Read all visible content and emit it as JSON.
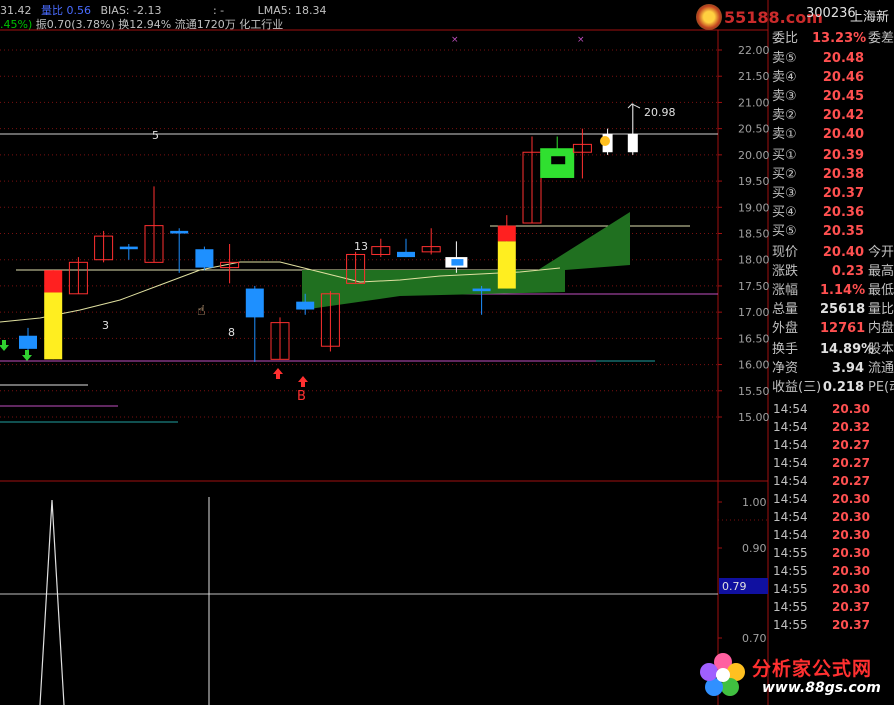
{
  "header": {
    "line1_left": "31.42",
    "line1_label": "量比",
    "line1_value": "0.56",
    "bias": "BIAS: -2.13",
    "colon": ": -",
    "lma": "LMA5: 18.34",
    "line2_pct": ".45%)",
    "line2_rest": "振0.70(3.78%) 换12.94% 流通1720万 化工行业"
  },
  "stock": {
    "code": "300236",
    "name": "上海新",
    "watermark": "55188.com"
  },
  "quote_panel": {
    "weibi": {
      "label": "委比",
      "value": "13.23%",
      "extra": "委差"
    },
    "asks": [
      {
        "label": "卖⑤",
        "value": "20.48"
      },
      {
        "label": "卖④",
        "value": "20.46"
      },
      {
        "label": "卖③",
        "value": "20.45"
      },
      {
        "label": "卖②",
        "value": "20.42"
      },
      {
        "label": "卖①",
        "value": "20.40"
      }
    ],
    "bids": [
      {
        "label": "买①",
        "value": "20.39"
      },
      {
        "label": "买②",
        "value": "20.38"
      },
      {
        "label": "买③",
        "value": "20.37"
      },
      {
        "label": "买④",
        "value": "20.36"
      },
      {
        "label": "买⑤",
        "value": "20.35"
      }
    ],
    "stats": [
      {
        "label": "现价",
        "value": "20.40",
        "extra": "今开",
        "color": "#ff5050"
      },
      {
        "label": "涨跌",
        "value": "0.23",
        "extra": "最高",
        "color": "#ff5050"
      },
      {
        "label": "涨幅",
        "value": "1.14%",
        "extra": "最低",
        "color": "#ff5050"
      },
      {
        "label": "总量",
        "value": "25618",
        "extra": "量比",
        "color": "#e0e0e0"
      },
      {
        "label": "外盘",
        "value": "12761",
        "extra": "内盘",
        "color": "#ff5050"
      }
    ],
    "stats2": [
      {
        "label": "换手",
        "value": "14.89%",
        "extra": "股本"
      },
      {
        "label": "净资",
        "value": "3.94",
        "extra": "流通"
      },
      {
        "label": "收益(三)",
        "value": "0.218",
        "extra": "PE(动"
      }
    ]
  },
  "ticks": [
    {
      "time": "14:54",
      "price": "20.30"
    },
    {
      "time": "14:54",
      "price": "20.32"
    },
    {
      "time": "14:54",
      "price": "20.27"
    },
    {
      "time": "14:54",
      "price": "20.27"
    },
    {
      "time": "14:54",
      "price": "20.27"
    },
    {
      "time": "14:54",
      "price": "20.30"
    },
    {
      "time": "14:54",
      "price": "20.30"
    },
    {
      "time": "14:54",
      "price": "20.30"
    },
    {
      "time": "14:55",
      "price": "20.30"
    },
    {
      "time": "14:55",
      "price": "20.30"
    },
    {
      "time": "14:55",
      "price": "20.30"
    },
    {
      "time": "14:55",
      "price": "20.37"
    },
    {
      "time": "14:55",
      "price": "20.37"
    }
  ],
  "site_logo": {
    "text": "分析家公式网",
    "url_text": "www.88gs.com"
  },
  "chart_data": {
    "type": "candlestick",
    "price_axis": {
      "ticks": [
        "22.00",
        "21.50",
        "21.00",
        "20.50",
        "20.00",
        "19.50",
        "19.00",
        "18.50",
        "18.00",
        "17.50",
        "17.00",
        "16.50",
        "16.00",
        "15.50",
        "15.00"
      ],
      "ylim": [
        14.5,
        22.5
      ]
    },
    "candles": [
      {
        "o": 16.55,
        "c": 16.3,
        "h": 16.7,
        "l": 16.25,
        "color": "#1e90ff"
      },
      {
        "o": 16.1,
        "c": 17.8,
        "h": 17.8,
        "l": 16.1,
        "color": "yellow_red"
      },
      {
        "o": 17.35,
        "c": 17.95,
        "h": 18.05,
        "l": 17.35,
        "color": "#ff3030"
      },
      {
        "o": 18.0,
        "c": 18.45,
        "h": 18.55,
        "l": 17.95,
        "color": "#ff3030"
      },
      {
        "o": 18.25,
        "c": 18.2,
        "h": 18.3,
        "l": 18.0,
        "color": "#1e90ff"
      },
      {
        "o": 17.95,
        "c": 18.65,
        "h": 19.4,
        "l": 17.95,
        "color": "#ff3030"
      },
      {
        "o": 18.55,
        "c": 18.5,
        "h": 18.6,
        "l": 17.75,
        "color": "#1e90ff"
      },
      {
        "o": 18.2,
        "c": 17.85,
        "h": 18.25,
        "l": 17.8,
        "color": "#1e90ff"
      },
      {
        "o": 17.85,
        "c": 17.95,
        "h": 18.3,
        "l": 17.55,
        "color": "#ff3030"
      },
      {
        "o": 17.45,
        "c": 16.9,
        "h": 17.5,
        "l": 16.05,
        "color": "#1e90ff"
      },
      {
        "o": 16.1,
        "c": 16.8,
        "h": 16.9,
        "l": 16.1,
        "color": "#ff3030"
      },
      {
        "o": 17.2,
        "c": 17.05,
        "h": 17.35,
        "l": 16.95,
        "color": "#1e90ff"
      },
      {
        "o": 16.35,
        "c": 17.35,
        "h": 17.4,
        "l": 16.25,
        "color": "#ff3030"
      },
      {
        "o": 17.55,
        "c": 18.1,
        "h": 18.15,
        "l": 17.55,
        "color": "#ff3030"
      },
      {
        "o": 18.1,
        "c": 18.25,
        "h": 18.4,
        "l": 18.05,
        "color": "#ff3030"
      },
      {
        "o": 18.15,
        "c": 18.05,
        "h": 18.4,
        "l": 18.05,
        "color": "#1e90ff"
      },
      {
        "o": 18.15,
        "c": 18.25,
        "h": 18.6,
        "l": 18.1,
        "color": "#ff3030"
      },
      {
        "o": 17.85,
        "c": 18.05,
        "h": 18.35,
        "l": 17.75,
        "color": "white_blue"
      },
      {
        "o": 17.45,
        "c": 17.4,
        "h": 17.5,
        "l": 16.95,
        "color": "#1e90ff"
      },
      {
        "o": 17.45,
        "c": 18.65,
        "h": 18.85,
        "l": 17.45,
        "color": "yellow_red"
      },
      {
        "o": 18.7,
        "c": 20.05,
        "h": 20.35,
        "l": 18.7,
        "color": "#ff3030"
      },
      {
        "o": 20.05,
        "c": 19.75,
        "h": 20.35,
        "l": 19.65,
        "color": "green_box"
      },
      {
        "o": 20.2,
        "c": 20.05,
        "h": 20.5,
        "l": 19.55,
        "color": "#ff3030"
      },
      {
        "o": 20.05,
        "c": 20.4,
        "h": 20.5,
        "l": 20.0,
        "color": "white"
      },
      {
        "o": 20.05,
        "c": 20.4,
        "h": 20.98,
        "l": 20.0,
        "color": "white"
      }
    ],
    "annotations": [
      "5",
      "13",
      "3",
      "8",
      "B",
      "20.98"
    ],
    "ma_line": [
      16.7,
      16.9,
      17.1,
      17.4,
      17.6,
      17.9,
      18.1,
      18.2,
      18.1,
      17.9,
      17.7,
      17.6,
      17.6,
      17.7,
      17.8
    ],
    "indicator_axis": {
      "ticks": [
        "1.00",
        "0.90",
        "0.79",
        "0.70"
      ],
      "current": "0.79"
    }
  }
}
